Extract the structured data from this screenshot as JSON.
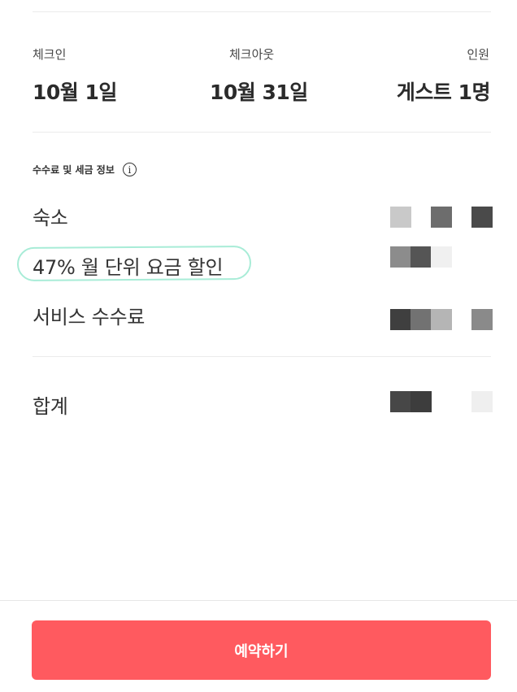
{
  "dates": {
    "checkin_label": "체크인",
    "checkin_value": "10월 1일",
    "checkout_label": "체크아웃",
    "checkout_value": "10월 31일",
    "guests_label": "인원",
    "guests_value": "게스트 1명"
  },
  "fees": {
    "section_title": "수수료 및 세금 정보",
    "info_icon_glyph": "i",
    "rows": [
      {
        "label": "숙소",
        "amount_redacted": true
      },
      {
        "label": "47% 월 단위 요금 할인",
        "amount_redacted": true
      },
      {
        "label": "서비스 수수료",
        "amount_redacted": true
      }
    ],
    "total_label": "합계",
    "total_redacted": true
  },
  "footer": {
    "reserve_label": "예약하기"
  },
  "colors": {
    "accent": "#ff5a5f",
    "highlight": "#a8ecd7",
    "divider": "#ebebeb"
  }
}
